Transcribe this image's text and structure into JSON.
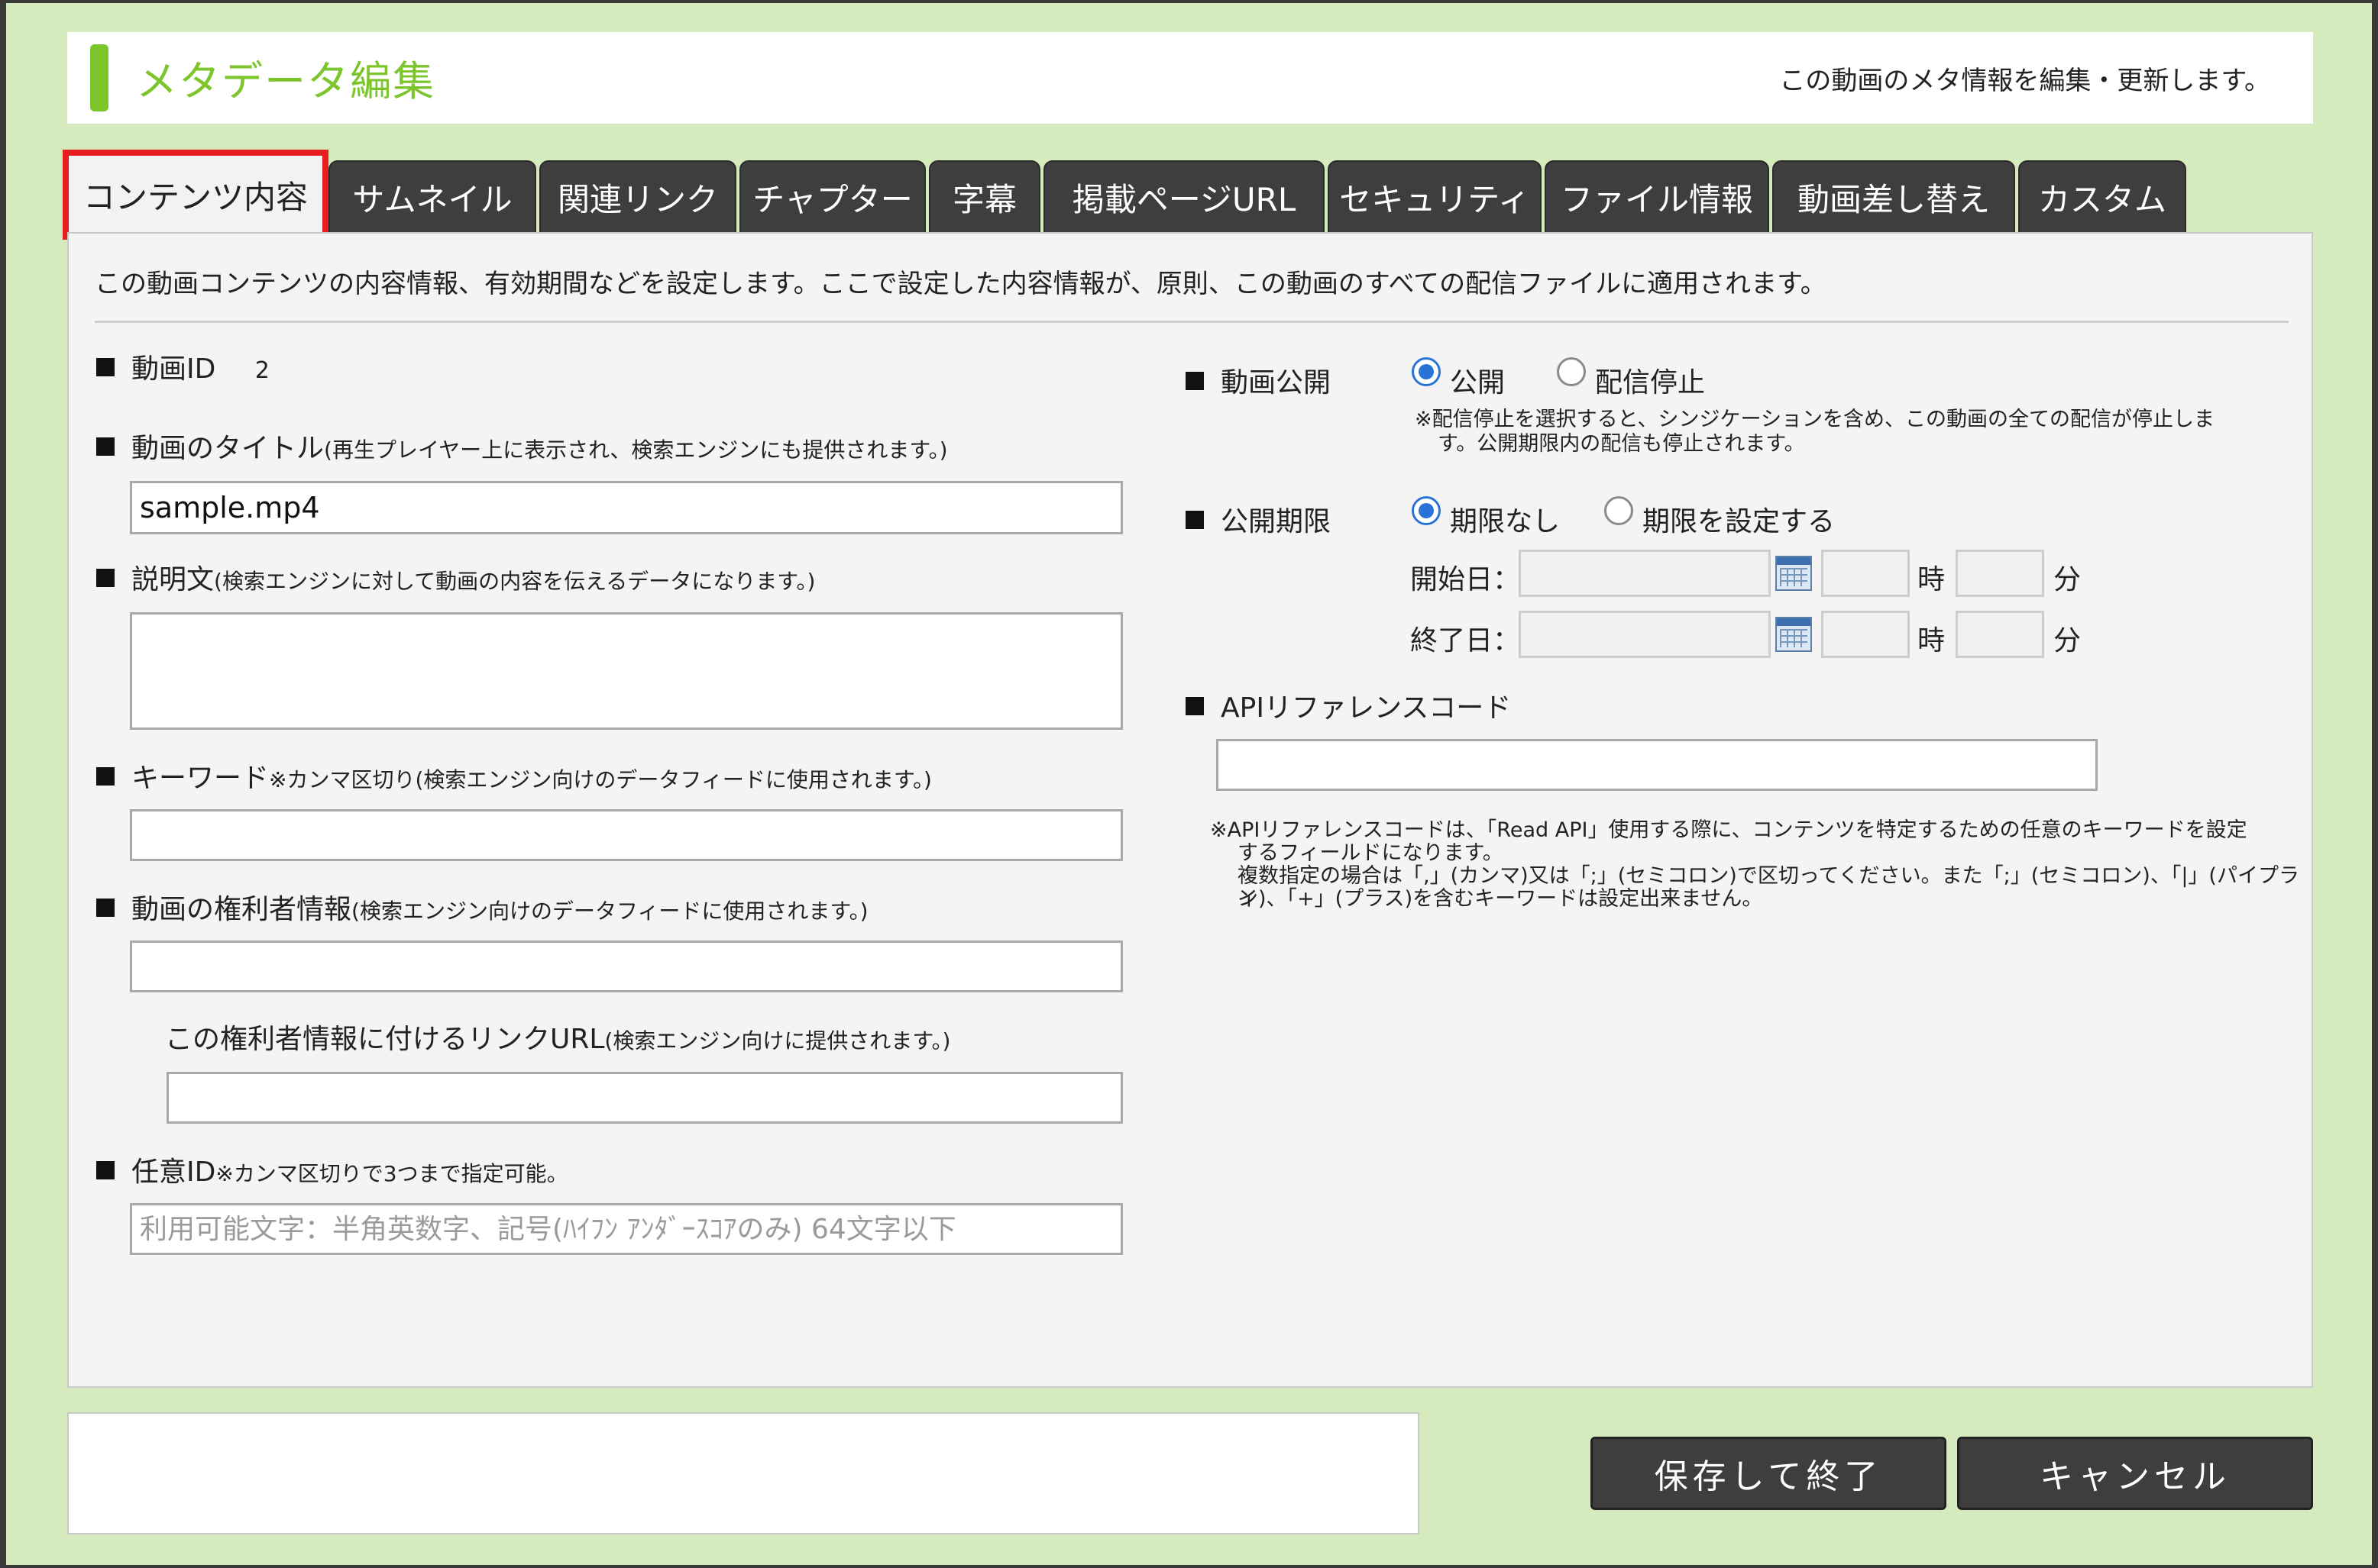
{
  "header": {
    "title": "メタデータ編集",
    "description": "この動画のメタ情報を編集・更新します。"
  },
  "tabs": [
    {
      "label": "コンテンツ内容",
      "active": true
    },
    {
      "label": "サムネイル"
    },
    {
      "label": "関連リンク"
    },
    {
      "label": "チャプター"
    },
    {
      "label": "字幕"
    },
    {
      "label": "掲載ページURL"
    },
    {
      "label": "セキュリティ"
    },
    {
      "label": "ファイル情報"
    },
    {
      "label": "動画差し替え"
    },
    {
      "label": "カスタム"
    }
  ],
  "intro": "この動画コンテンツの内容情報、有効期間などを設定します。ここで設定した内容情報が、原則、この動画のすべての配信ファイルに適用されます。",
  "left": {
    "video_id_label": "動画ID",
    "video_id_value": "2",
    "title_label": "動画のタイトル",
    "title_note": "(再生プレイヤー上に表示され、検索エンジンにも提供されます。)",
    "title_value": "sample.mp4",
    "desc_label": "説明文",
    "desc_note": "(検索エンジンに対して動画の内容を伝えるデータになります。)",
    "keyword_label": "キーワード",
    "keyword_note": "※カンマ区切り(検索エンジン向けのデータフィードに使用されます。)",
    "rights_label": "動画の権利者情報",
    "rights_note": "(検索エンジン向けのデータフィードに使用されます。)",
    "rights_link_label": "この権利者情報に付けるリンクURL",
    "rights_link_note": "(検索エンジン向けに提供されます。)",
    "any_id_label": "任意ID",
    "any_id_note": "※カンマ区切りで3つまで指定可能。",
    "any_id_placeholder": "利用可能文字：半角英数字、記号(ﾊｲﾌﾝ ｱﾝﾀﾞｰｽｺｱのみ) 64文字以下"
  },
  "right": {
    "publish_label": "動画公開",
    "publish_options": [
      "公開",
      "配信停止"
    ],
    "publish_selected": "公開",
    "publish_note_1": "※配信停止を選択すると、シンジケーションを含め、この動画の全ての配信が停止しま",
    "publish_note_2": "す。公開期限内の配信も停止されます。",
    "period_label": "公開期限",
    "period_options": [
      "期限なし",
      "期限を設定する"
    ],
    "period_selected": "期限なし",
    "start_label": "開始日：",
    "end_label": "終了日：",
    "hour_label": "時",
    "minute_label": "分",
    "api_label": "APIリファレンスコード",
    "api_note_1": "※APIリファレンスコードは、「Read API」使用する際に、コンテンツを特定するための任意のキーワードを設定",
    "api_note_2": "するフィールドになります。",
    "api_note_3": "複数指定の場合は「,」(カンマ)又は「;」(セミコロン)で区切ってください。また「;」(セミコロン)、「|」(パイプライ",
    "api_note_4": "ン)、「+」(プラス)を含むキーワードは設定出来ません。"
  },
  "footer": {
    "save_label": "保存して終了",
    "cancel_label": "キャンセル"
  },
  "colors": {
    "background": "#d5ebbd",
    "accent_green": "#7cc52b",
    "tab_dark": "#3e3e3e",
    "active_tab_outline": "#e61e1e",
    "radio_blue": "#2a73d6"
  },
  "icons": [
    "calendar-icon"
  ]
}
